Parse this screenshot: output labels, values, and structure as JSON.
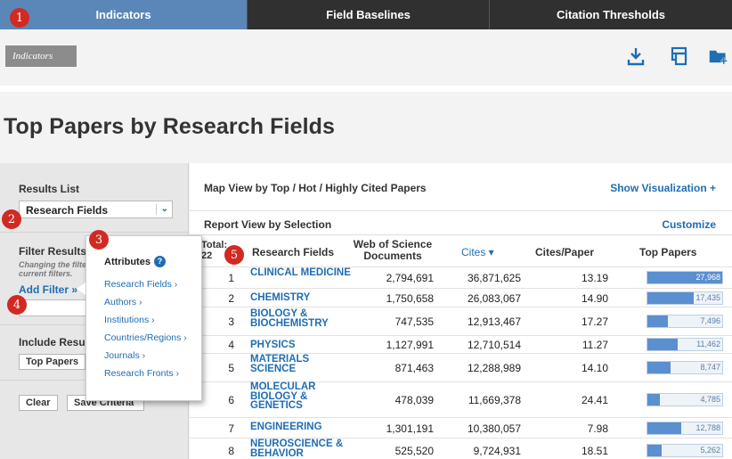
{
  "tabs": [
    {
      "label": "Indicators"
    },
    {
      "label": "Field Baselines"
    },
    {
      "label": "Citation Thresholds"
    }
  ],
  "markers": [
    "1",
    "2",
    "3",
    "4",
    "5"
  ],
  "toolbar": {
    "breadcrumb": "Indicators",
    "icons": [
      "download-icon",
      "print-icon",
      "add-folder-icon"
    ]
  },
  "page_title": "Top Papers by Research Fields",
  "sidebar": {
    "results_list_label": "Results List",
    "results_list_value": "Research Fields",
    "filter_results_label": "Filter Results",
    "filter_hint": "Changing the filter current filters.",
    "add_filter": "Add Filter »",
    "include_results_label": "Include Results",
    "include_value": "Top Papers",
    "clear": "Clear",
    "save_criteria": "Save Criteria"
  },
  "popup": {
    "title": "Attributes",
    "help": "?",
    "items": [
      {
        "label": "Research Fields ›"
      },
      {
        "label": "Authors ›"
      },
      {
        "label": "Institutions ›"
      },
      {
        "label": "Countries/Regions ›"
      },
      {
        "label": "Journals ›"
      },
      {
        "label": "Research Fronts ›"
      }
    ]
  },
  "main": {
    "map_view": "Map View by Top / Hot / Highly Cited Papers",
    "show_visualization": "Show Visualization +",
    "report_view": "Report View by Selection",
    "customize": "Customize",
    "total_label": "Total:",
    "total_value": "22",
    "headers": {
      "field": "Research Fields",
      "docs": "Web of Science Documents",
      "cites": "Cites ▾",
      "cites_per_paper": "Cites/Paper",
      "top_papers": "Top Papers"
    },
    "rows": [
      {
        "rank": "1",
        "field": "CLINICAL MEDICINE",
        "docs": "2,794,691",
        "cites": "36,871,625",
        "cpp": "13.19",
        "top": "27,968",
        "top_num": 27968
      },
      {
        "rank": "2",
        "field": "CHEMISTRY",
        "docs": "1,750,658",
        "cites": "26,083,067",
        "cpp": "14.90",
        "top": "17,435",
        "top_num": 17435
      },
      {
        "rank": "3",
        "field": "BIOLOGY & BIOCHEMISTRY",
        "docs": "747,535",
        "cites": "12,913,467",
        "cpp": "17.27",
        "top": "7,496",
        "top_num": 7496
      },
      {
        "rank": "4",
        "field": "PHYSICS",
        "docs": "1,127,991",
        "cites": "12,710,514",
        "cpp": "11.27",
        "top": "11,462",
        "top_num": 11462
      },
      {
        "rank": "5",
        "field": "MATERIALS SCIENCE",
        "docs": "871,463",
        "cites": "12,288,989",
        "cpp": "14.10",
        "top": "8,747",
        "top_num": 8747
      },
      {
        "rank": "6",
        "field": "MOLECULAR BIOLOGY & GENETICS",
        "docs": "478,039",
        "cites": "11,669,378",
        "cpp": "24.41",
        "top": "4,785",
        "top_num": 4785
      },
      {
        "rank": "7",
        "field": "ENGINEERING",
        "docs": "1,301,191",
        "cites": "10,380,057",
        "cpp": "7.98",
        "top": "12,788",
        "top_num": 12788
      },
      {
        "rank": "8",
        "field": "NEUROSCIENCE & BEHAVIOR",
        "docs": "525,520",
        "cites": "9,724,931",
        "cpp": "18.51",
        "top": "5,262",
        "top_num": 5262
      }
    ]
  }
}
